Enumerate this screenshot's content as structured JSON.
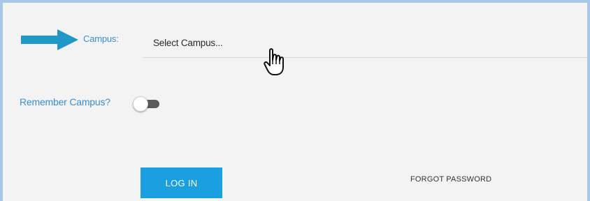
{
  "form": {
    "campus_label": "Campus:",
    "campus_select_value": "Select Campus...",
    "remember_label": "Remember Campus?",
    "remember_toggle_on": false,
    "login_label": "LOG IN",
    "forgot_label": "FORGOT PASSWORD"
  },
  "colors": {
    "accent": "#1a9fe0",
    "label_blue": "#3b8fd0",
    "arrow": "#1f97c7",
    "frame_border": "#aac7e6"
  },
  "icons": {
    "annotation": "arrow-right-icon",
    "cursor": "hand-pointer-icon"
  }
}
